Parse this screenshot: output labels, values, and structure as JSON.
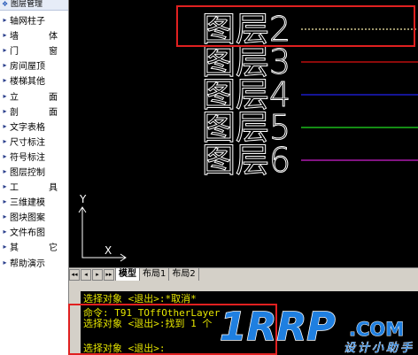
{
  "sidebar": {
    "header": "图层管理",
    "items": [
      {
        "label": "轴网柱子",
        "spread": false
      },
      {
        "label": "墙　　体",
        "spread": true,
        "parts": [
          "墙",
          "体"
        ]
      },
      {
        "label": "门　　窗",
        "spread": true,
        "parts": [
          "门",
          "窗"
        ]
      },
      {
        "label": "房间屋顶",
        "spread": false
      },
      {
        "label": "楼梯其他",
        "spread": false
      },
      {
        "label": "立　　面",
        "spread": true,
        "parts": [
          "立",
          "面"
        ]
      },
      {
        "label": "剖　　面",
        "spread": true,
        "parts": [
          "剖",
          "面"
        ]
      },
      {
        "label": "文字表格",
        "spread": false
      },
      {
        "label": "尺寸标注",
        "spread": false
      },
      {
        "label": "符号标注",
        "spread": false
      },
      {
        "label": "图层控制",
        "spread": false
      },
      {
        "label": "工　　具",
        "spread": true,
        "parts": [
          "工",
          "具"
        ]
      },
      {
        "label": "三维建模",
        "spread": false
      },
      {
        "label": "图块图案",
        "spread": false
      },
      {
        "label": "文件布图",
        "spread": false
      },
      {
        "label": "其　　它",
        "spread": true,
        "parts": [
          "其",
          "它"
        ]
      },
      {
        "label": "帮助演示",
        "spread": false
      }
    ]
  },
  "canvas": {
    "layers": [
      {
        "label": "图层2",
        "line_color": "#f5e9a8",
        "dotted": true
      },
      {
        "label": "图层3",
        "line_color": "#e01010",
        "dotted": false
      },
      {
        "label": "图层4",
        "line_color": "#2020f0",
        "dotted": false
      },
      {
        "label": "图层5",
        "line_color": "#20e020",
        "dotted": false
      },
      {
        "label": "图层6",
        "line_color": "#d020d0",
        "dotted": false
      }
    ],
    "ucs_y_label": "Y",
    "ucs_x_label": "X",
    "text_color": "#ffffff"
  },
  "tabs": {
    "nav_buttons": [
      "◂◂",
      "◂",
      "▸",
      "▸▸"
    ],
    "items": [
      {
        "label": "模型",
        "active": true
      },
      {
        "label": "布局1",
        "active": false
      },
      {
        "label": "布局2",
        "active": false
      }
    ]
  },
  "command": {
    "lines": [
      "选择对象 <退出>:*取消*",
      "命令: T91_TOffOtherLayer",
      "选择对象 <退出>:找到 1 个",
      "",
      "选择对象 <退出>:"
    ]
  },
  "watermark": {
    "brand": "1RRP",
    "suffix": ".COM",
    "tagline": "设计小助手"
  },
  "colors": {
    "highlight": "#e02020",
    "command_text": "#e6e600",
    "watermark_blue": "#1f7fe0"
  }
}
